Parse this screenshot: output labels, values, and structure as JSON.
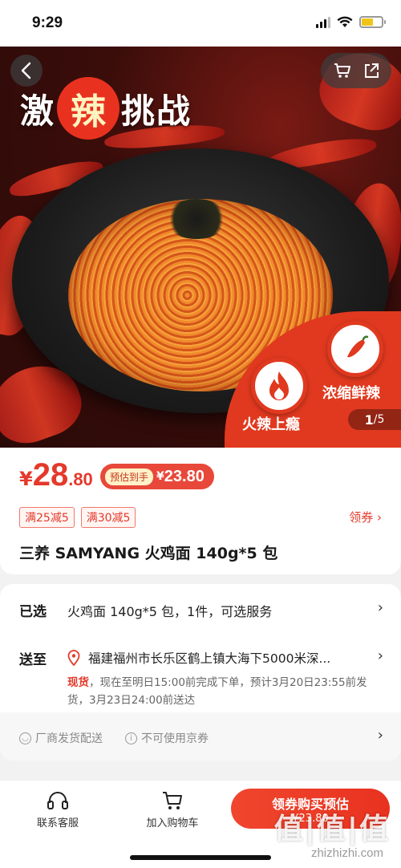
{
  "status_bar": {
    "time": "9:29"
  },
  "hero": {
    "title_left": "激",
    "title_highlight": "辣",
    "title_right": "挑战",
    "badge_1": "火辣上瘾",
    "badge_2": "浓缩鲜辣",
    "pager_current": "1",
    "pager_total": "/5"
  },
  "price": {
    "currency": "¥",
    "integer": "28",
    "decimal": ".80",
    "estimate_label": "预估到手",
    "estimate_currency": "¥",
    "estimate_value": "23.80"
  },
  "coupons": [
    "满25减5",
    "满30减5"
  ],
  "get_coupon": "领券",
  "product_title": "三养 SAMYANG 火鸡面 140g*5 包",
  "spec": {
    "selected_label": "已选",
    "selected_value": "火鸡面 140g*5 包，1件，可选服务",
    "ship_label": "送至",
    "address": "福建福州市长乐区鹤上镇大海下5000米深...",
    "stock_status": "现货",
    "stock_detail": "，现在至明日15:00前完成下单，预计3月20日23:55前发货，3月23日24:00前送达",
    "service_1": "厂商发货配送",
    "service_2": "不可使用京券"
  },
  "bottom_bar": {
    "service_label": "联系客服",
    "cart_label": "加入购物车",
    "buy_label": "领券购买预估",
    "buy_sub": "¥23.80"
  },
  "watermark": {
    "logo": "值|值|值",
    "site": "zhizhizhi.com"
  },
  "colors": {
    "accent": "#e4392b",
    "hero_red": "#e0391f"
  }
}
